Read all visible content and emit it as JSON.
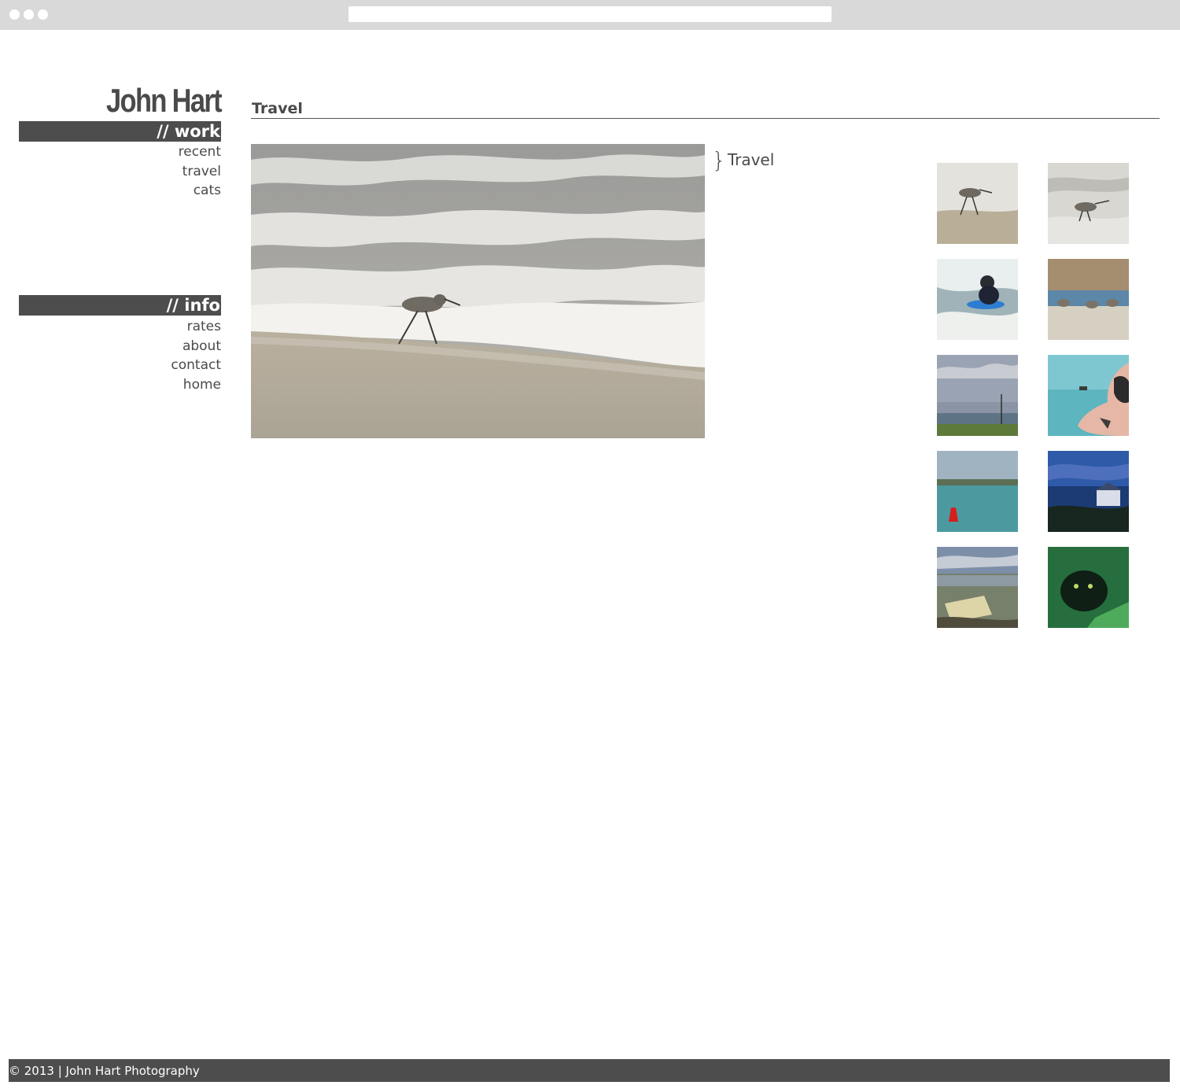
{
  "site": {
    "brand": "John Hart"
  },
  "sidebar": {
    "work_heading": "// work",
    "work_items": [
      "recent",
      "travel",
      "cats"
    ],
    "info_heading": "// info",
    "info_items": [
      "rates",
      "about",
      "contact",
      "home"
    ]
  },
  "main": {
    "title": "Travel",
    "photo_caption": "Travel",
    "caption_brace": "}"
  },
  "thumbnails": [
    "sandpiper-in-surf",
    "sandpiper-on-foam",
    "boogie-boarder",
    "birds-on-sand",
    "harbor-cloudy-sky",
    "tattooed-arm-boat",
    "red-buoy-water",
    "houses-at-dusk",
    "hilltop-sign",
    "black-cat-green"
  ],
  "footer": {
    "text": "© 2013 | John Hart Photography"
  },
  "colors": {
    "dark_gray": "#4d4d4d",
    "text_gray": "#4a4a4a",
    "chrome_gray": "#d9d9d9"
  }
}
